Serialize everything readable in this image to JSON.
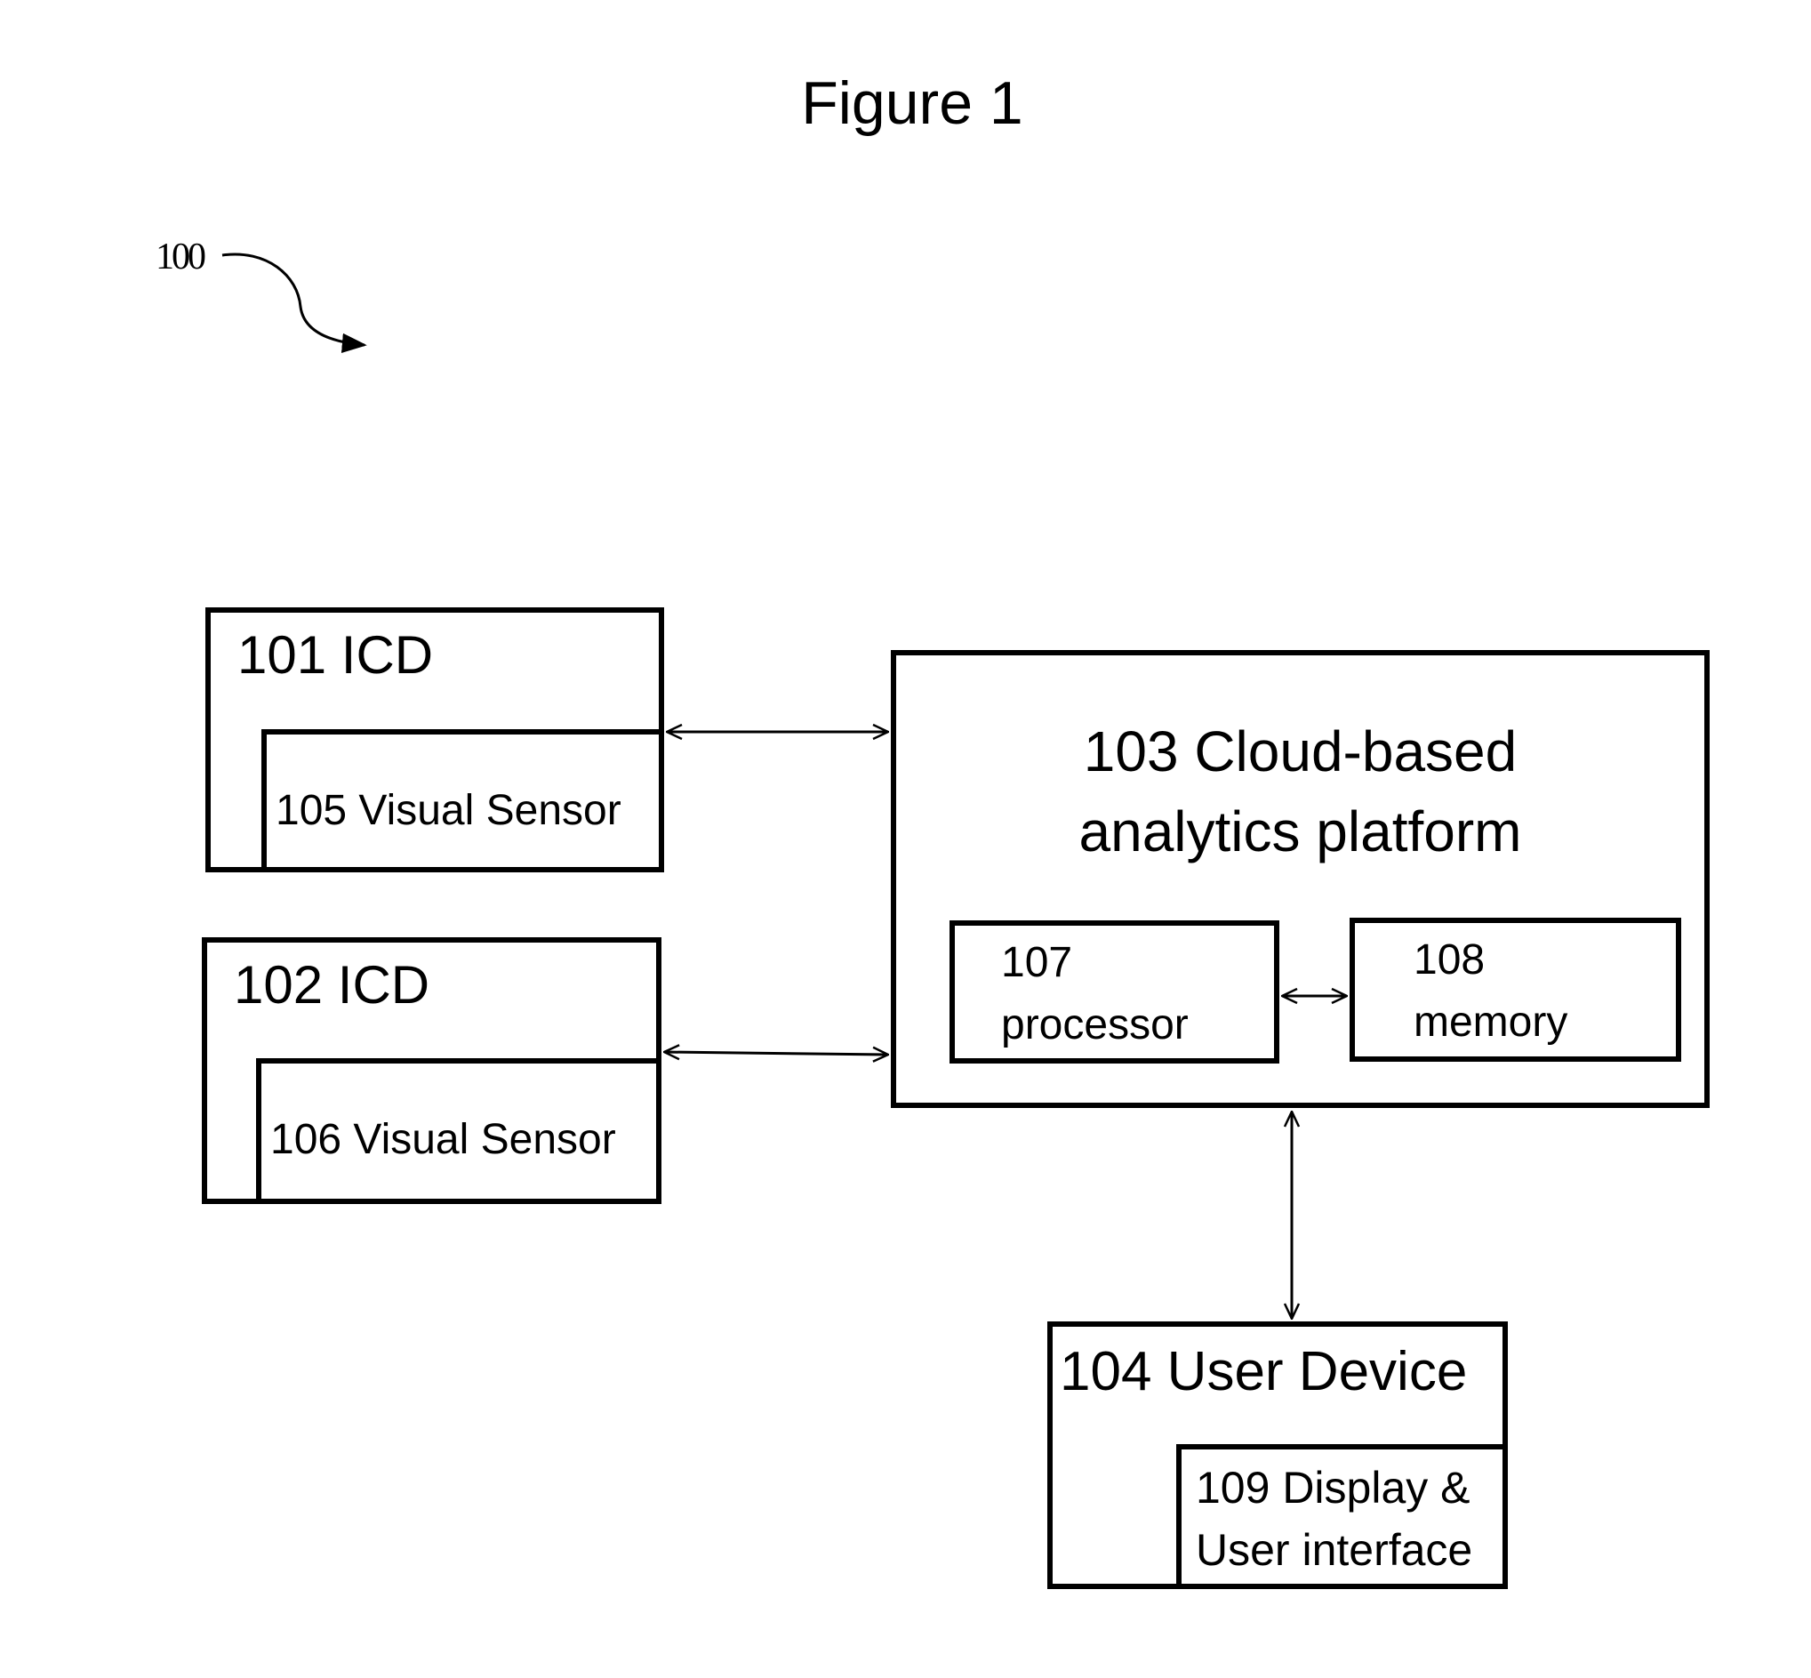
{
  "figure": {
    "title": "Figure 1",
    "reference_label": "100"
  },
  "nodes": {
    "icd_101": {
      "label": "101 ICD",
      "child": {
        "label": "105 Visual Sensor"
      }
    },
    "icd_102": {
      "label": "102 ICD",
      "child": {
        "label": "106 Visual Sensor"
      }
    },
    "platform_103": {
      "line1": "103 Cloud-based",
      "line2": "analytics platform",
      "processor_107": {
        "line1": "107",
        "line2": "processor"
      },
      "memory_108": {
        "line1": "108",
        "line2": "memory"
      }
    },
    "user_device_104": {
      "label": "104 User Device",
      "child": {
        "line1": "109 Display &",
        "line2": "User interface"
      }
    }
  },
  "edges": [
    {
      "from": "101 ICD",
      "to": "103 Cloud-based analytics platform",
      "direction": "bidirectional"
    },
    {
      "from": "102 ICD",
      "to": "103 Cloud-based analytics platform",
      "direction": "bidirectional"
    },
    {
      "from": "107 processor",
      "to": "108 memory",
      "direction": "bidirectional"
    },
    {
      "from": "103 Cloud-based analytics platform",
      "to": "104 User Device",
      "direction": "bidirectional"
    }
  ]
}
